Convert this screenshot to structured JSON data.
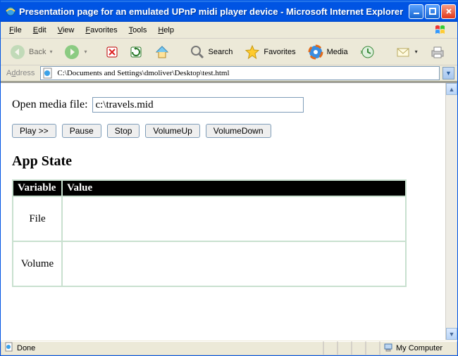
{
  "window": {
    "title": "Presentation page for an emulated UPnP midi player device - Microsoft Internet Explorer"
  },
  "menu": {
    "file": "File",
    "edit": "Edit",
    "view": "View",
    "favorites": "Favorites",
    "tools": "Tools",
    "help": "Help"
  },
  "toolbar": {
    "back": "Back",
    "search": "Search",
    "favorites": "Favorites",
    "media": "Media"
  },
  "address": {
    "label": "Address",
    "value": "C:\\Documents and Settings\\dmoliver\\Desktop\\test.html"
  },
  "page": {
    "open_label": "Open media file:",
    "open_value": "c:\\travels.mid",
    "buttons": {
      "play": "Play >>",
      "pause": "Pause",
      "stop": "Stop",
      "vol_up": "VolumeUp",
      "vol_down": "VolumeDown"
    },
    "section_heading": "App State",
    "table": {
      "head_variable": "Variable",
      "head_value": "Value",
      "rows": [
        {
          "variable": "File",
          "value": ""
        },
        {
          "variable": "Volume",
          "value": ""
        }
      ]
    }
  },
  "status": {
    "text": "Done",
    "zone": "My Computer"
  }
}
